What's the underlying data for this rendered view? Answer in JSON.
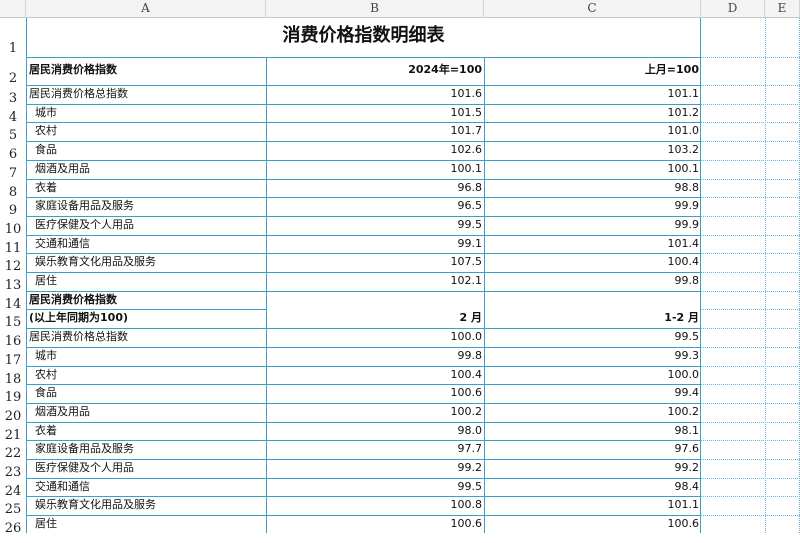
{
  "columns": [
    "A",
    "B",
    "C",
    "D",
    "E"
  ],
  "title": "消费价格指数明细表",
  "section1": {
    "header": {
      "label": "居民消费价格指数",
      "col_b": "2024年=100",
      "col_c": "上月=100"
    },
    "rows": [
      {
        "label": "居民消费价格总指数",
        "b": "101.6",
        "c": "101.1"
      },
      {
        "label": "城市",
        "b": "101.5",
        "c": "101.2"
      },
      {
        "label": "农村",
        "b": "101.7",
        "c": "101.0"
      },
      {
        "label": "食品",
        "b": "102.6",
        "c": "103.2"
      },
      {
        "label": "烟酒及用品",
        "b": "100.1",
        "c": "100.1"
      },
      {
        "label": "衣着",
        "b": "96.8",
        "c": "98.8"
      },
      {
        "label": "家庭设备用品及服务",
        "b": "96.5",
        "c": "99.9"
      },
      {
        "label": "医疗保健及个人用品",
        "b": "99.5",
        "c": "99.9"
      },
      {
        "label": "交通和通信",
        "b": "99.1",
        "c": "101.4"
      },
      {
        "label": "娱乐教育文化用品及服务",
        "b": "107.5",
        "c": "100.4"
      },
      {
        "label": "居住",
        "b": "102.1",
        "c": "99.8"
      }
    ]
  },
  "section2": {
    "header_line1": "居民消费价格指数",
    "header_line2": "(以上年同期为100)",
    "col_b": "2 月",
    "col_c": "1-2 月",
    "rows": [
      {
        "label": "居民消费价格总指数",
        "b": "100.0",
        "c": "99.5"
      },
      {
        "label": "城市",
        "b": "99.8",
        "c": "99.3"
      },
      {
        "label": "农村",
        "b": "100.4",
        "c": "100.0"
      },
      {
        "label": "食品",
        "b": "100.6",
        "c": "99.4"
      },
      {
        "label": "烟酒及用品",
        "b": "100.2",
        "c": "100.2"
      },
      {
        "label": "衣着",
        "b": "98.0",
        "c": "98.1"
      },
      {
        "label": "家庭设备用品及服务",
        "b": "97.7",
        "c": "97.6"
      },
      {
        "label": "医疗保健及个人用品",
        "b": "99.2",
        "c": "99.2"
      },
      {
        "label": "交通和通信",
        "b": "99.5",
        "c": "98.4"
      },
      {
        "label": "娱乐教育文化用品及服务",
        "b": "100.8",
        "c": "101.1"
      },
      {
        "label": "居住",
        "b": "100.6",
        "c": "100.6"
      }
    ]
  },
  "colors": {
    "table_border": "#3aa0c8",
    "grid_dotted": "#6ab8e0",
    "header_bg": "#f3f3f3"
  }
}
